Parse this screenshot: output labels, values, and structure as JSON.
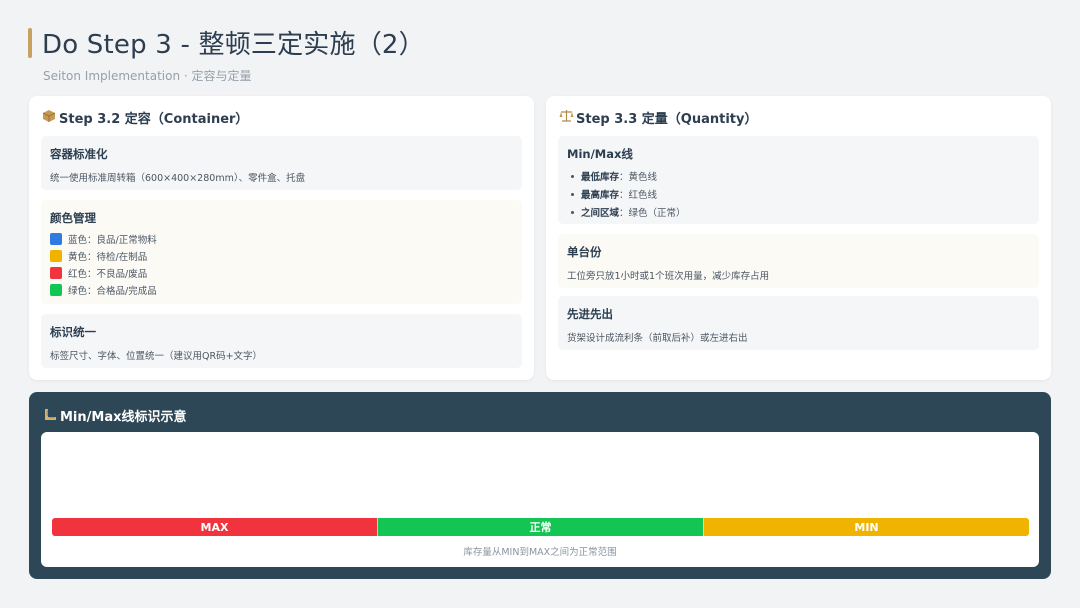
{
  "header": {
    "title": "Do Step 3 - 整顿三定实施（2）",
    "subtitle": "Seiton Implementation · 定容与定量"
  },
  "colors": {
    "accent": "#c8a060",
    "panel_bg": "#2d4756",
    "blue": "#2f7be0",
    "yellow": "#efb300",
    "red": "#f0333c",
    "green": "#13c552"
  },
  "container": {
    "title": "Step 3.2 定容（Container）",
    "icon": "box-icon",
    "standardize": {
      "title": "容器标准化",
      "text": "统一使用标准周转箱（600×400×280mm）、零件盒、托盘"
    },
    "color_mgmt": {
      "title": "颜色管理",
      "items": [
        {
          "color": "#2f7be0",
          "label": "蓝色：良品/正常物料"
        },
        {
          "color": "#efb300",
          "label": "黄色：待检/在制品"
        },
        {
          "color": "#f0333c",
          "label": "红色：不良品/废品"
        },
        {
          "color": "#13c552",
          "label": "绿色：合格品/完成品"
        }
      ]
    },
    "labeling": {
      "title": "标识统一",
      "text": "标签尺寸、字体、位置统一（建议用QR码+文字）"
    }
  },
  "quantity": {
    "title": "Step 3.3 定量（Quantity）",
    "icon": "balance-scale-icon",
    "minmax": {
      "title": "Min/Max线",
      "items": [
        {
          "key": "最低库存",
          "value": "：黄色线"
        },
        {
          "key": "最高库存",
          "value": "：红色线"
        },
        {
          "key": "之间区域",
          "value": "：绿色（正常）"
        }
      ]
    },
    "single": {
      "title": "单台份",
      "text": "工位旁只放1小时或1个班次用量，减少库存占用"
    },
    "fifo": {
      "title": "先进先出",
      "text": "货架设计成流利条（前取后补）或左进右出"
    }
  },
  "demo": {
    "title": "Min/Max线标识示意",
    "icon": "ruler-icon",
    "segments": [
      {
        "label": "MAX",
        "color": "#f0333c"
      },
      {
        "label": "正常",
        "color": "#13c552"
      },
      {
        "label": "MIN",
        "color": "#efb300"
      }
    ],
    "caption": "库存量从MIN到MAX之间为正常范围"
  }
}
